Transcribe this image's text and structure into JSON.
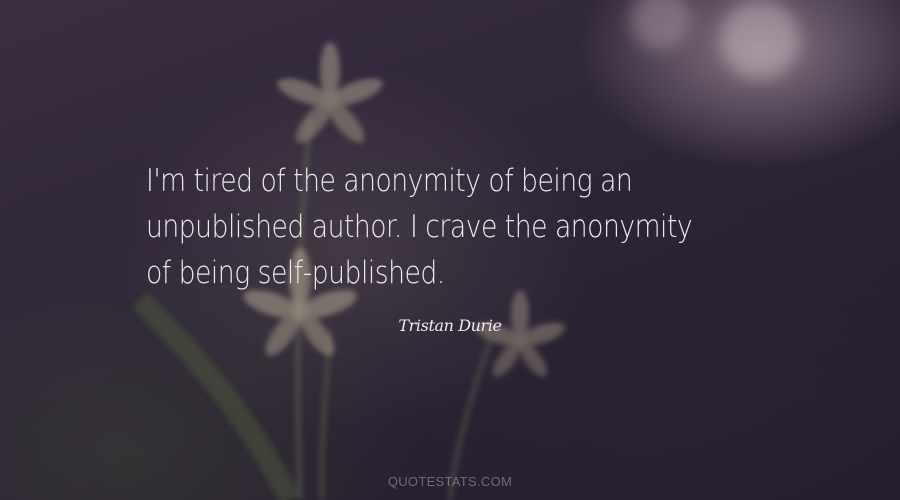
{
  "quote": {
    "lines": [
      "I'm tired of the anonymity of being an",
      "unpublished author. I crave the anonymity",
      "of being self-published."
    ]
  },
  "author": "Tristan Durie",
  "watermark": "QUOTESTATS.COM",
  "colors": {
    "background": "#2e2538",
    "text": "#eeeaf0",
    "watermark": "#a99fb5"
  },
  "icons": [
    "flower-illustration"
  ]
}
